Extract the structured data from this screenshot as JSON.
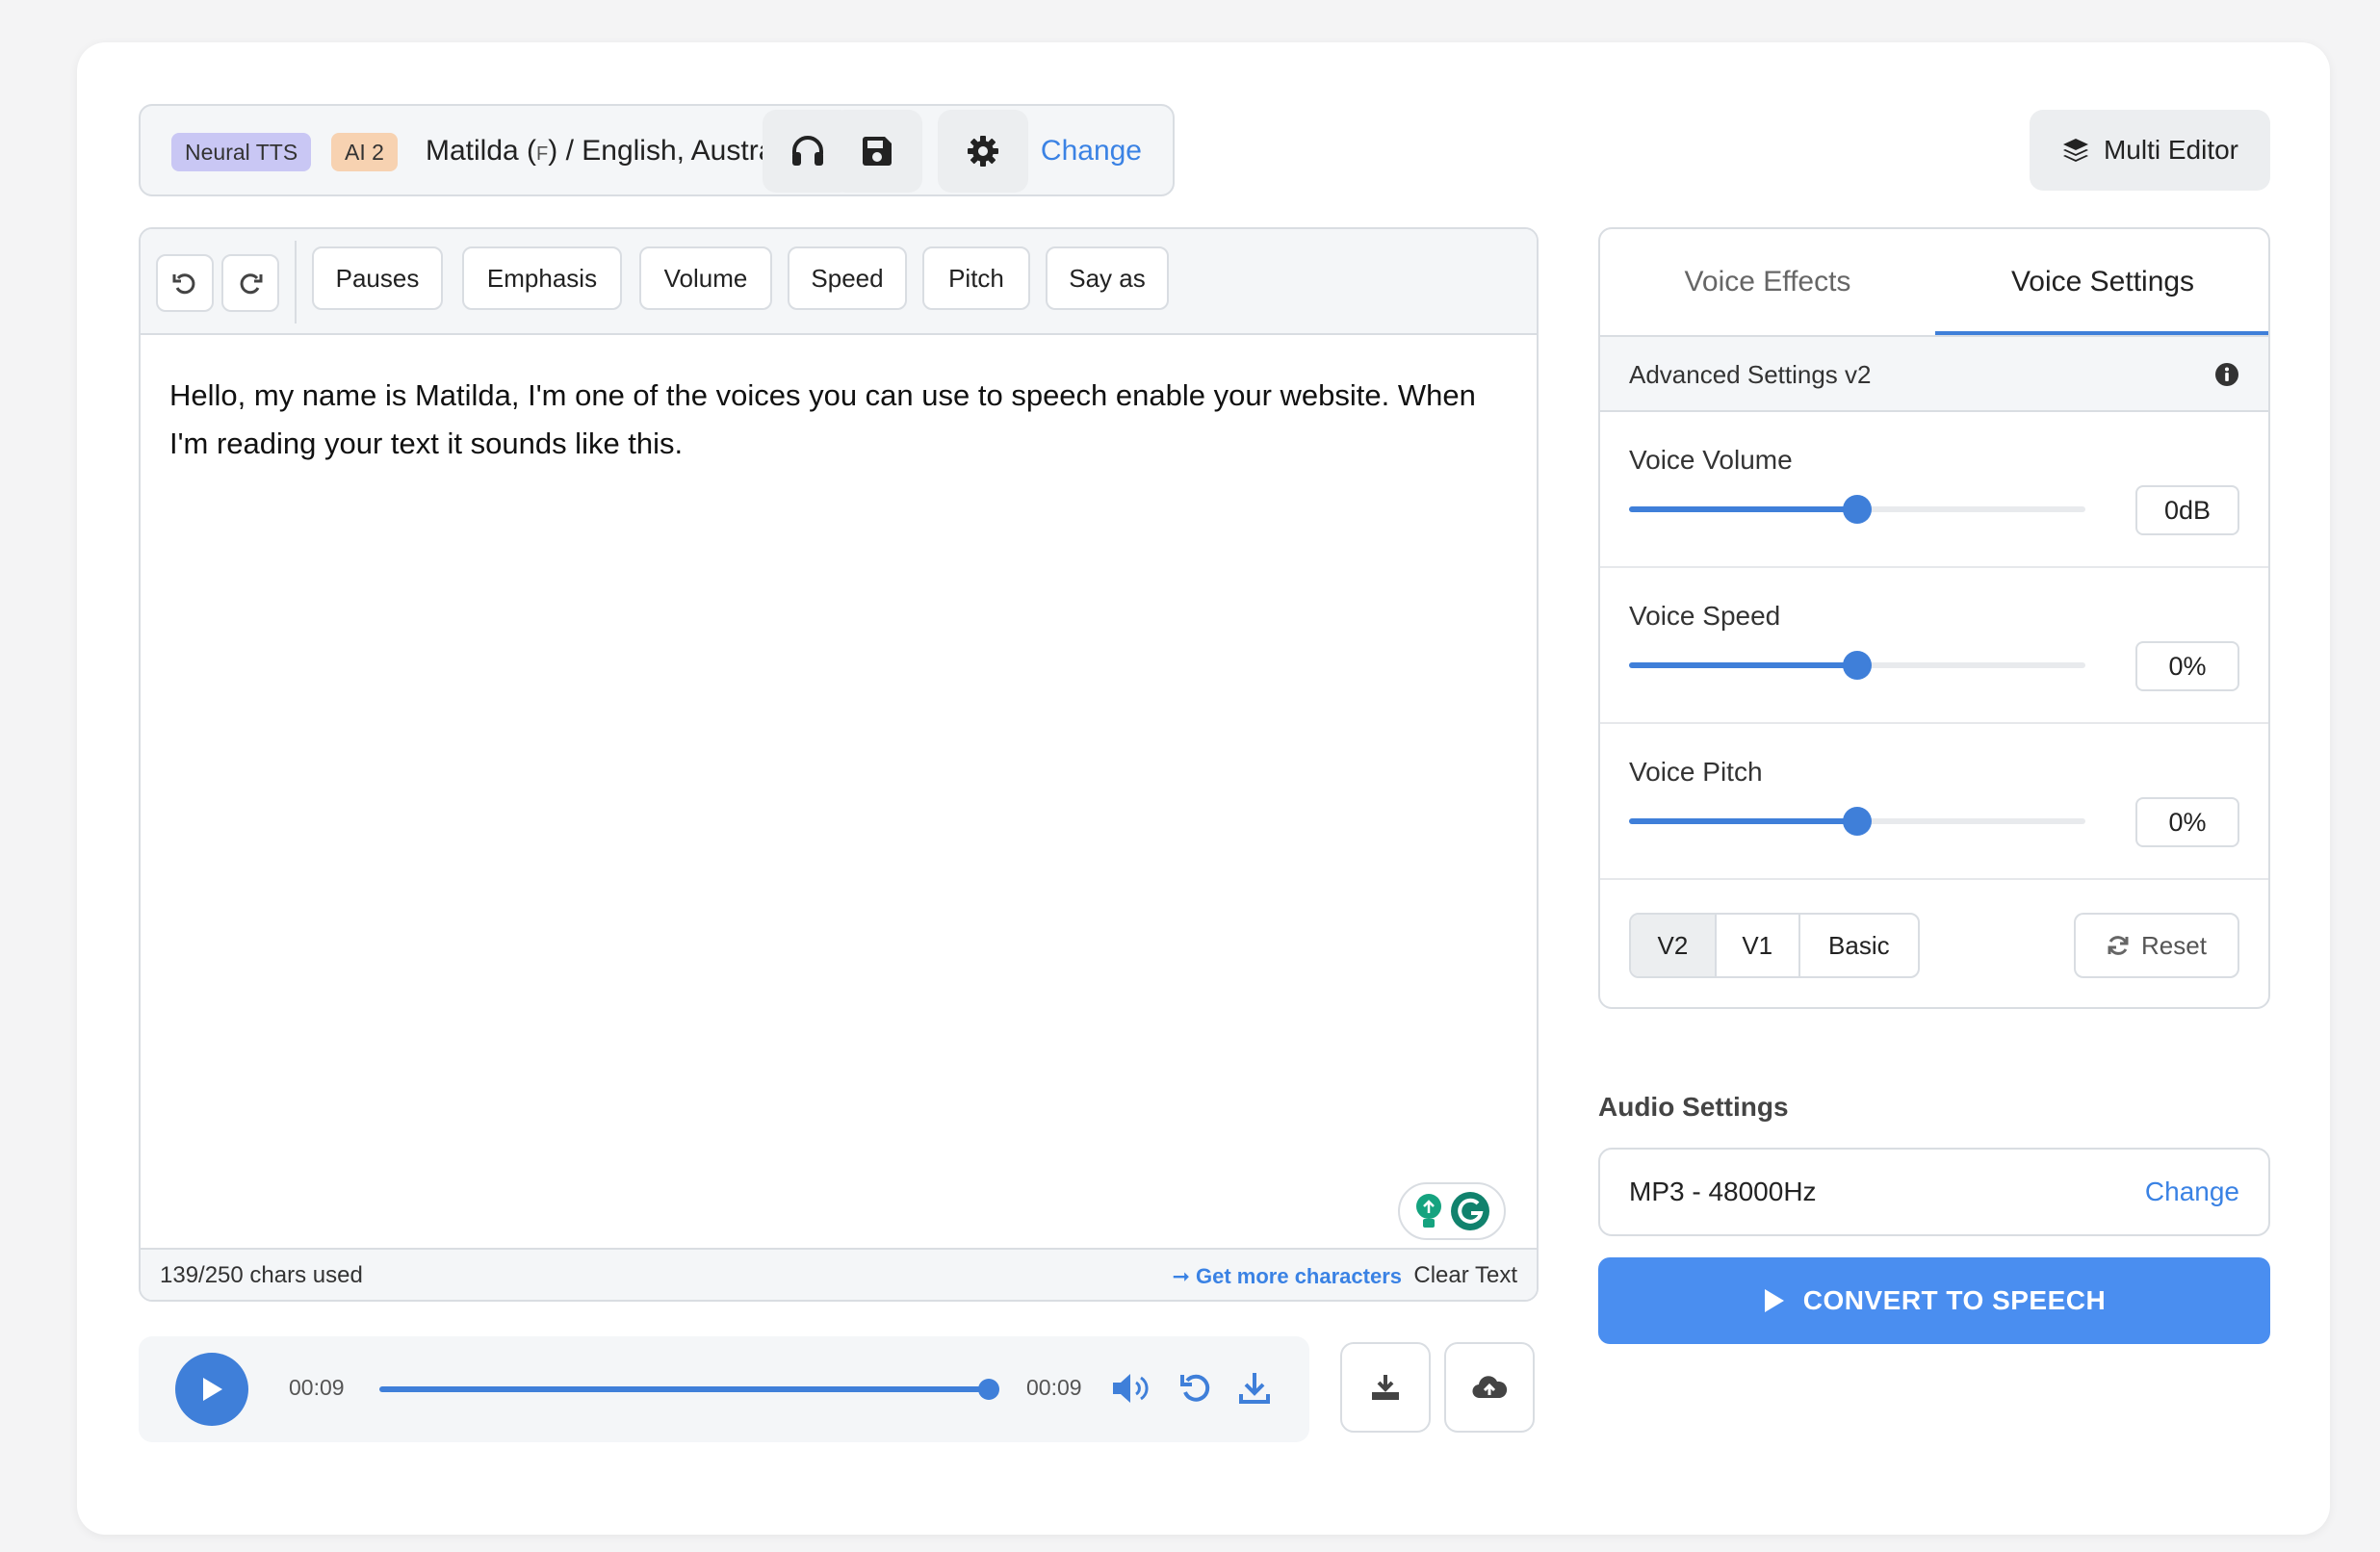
{
  "voice": {
    "engine_badge": "Neural TTS",
    "model_badge": "AI 2",
    "name": "Matilda (",
    "gender": "F",
    "name_suffix": ") / English, Australian",
    "change_label": "Change"
  },
  "header_actions": {
    "listen_icon": "headphones-icon",
    "save_icon": "save-icon",
    "settings_icon": "gear-icon",
    "multi_editor_label": "Multi Editor",
    "multi_editor_icon": "layers-icon"
  },
  "editor": {
    "toolbar": {
      "undo_icon": "undo-icon",
      "redo_icon": "redo-icon",
      "buttons": [
        "Pauses",
        "Emphasis",
        "Volume",
        "Speed",
        "Pitch",
        "Say as"
      ]
    },
    "text": "Hello, my name is Matilda, I'm one of the voices you can use to speech enable your website. When I'm reading your text it sounds like this.",
    "chars_used": "139/250 chars used",
    "get_more_label": "➞ Get more characters",
    "clear_label": "Clear Text"
  },
  "player": {
    "current_time": "00:09",
    "total_time": "00:09",
    "progress": 1.0,
    "icons": [
      "play-icon",
      "volume-icon",
      "replay-icon",
      "download-icon"
    ],
    "side_buttons": [
      "download-tray-icon",
      "cloud-upload-icon"
    ]
  },
  "right_panel": {
    "tabs": [
      {
        "label": "Voice Effects",
        "active": false
      },
      {
        "label": "Voice Settings",
        "active": true
      }
    ],
    "advanced_title": "Advanced Settings v2",
    "settings": [
      {
        "label": "Voice Volume",
        "value": "0dB",
        "level": 0.5
      },
      {
        "label": "Voice Speed",
        "value": "0%",
        "level": 0.5
      },
      {
        "label": "Voice Pitch",
        "value": "0%",
        "level": 0.5
      }
    ],
    "versions": [
      {
        "label": "V2",
        "active": true
      },
      {
        "label": "V1",
        "active": false
      },
      {
        "label": "Basic",
        "active": false
      }
    ],
    "reset_label": "Reset"
  },
  "audio": {
    "section_label": "Audio Settings",
    "format": "MP3 - 48000Hz",
    "change_label": "Change"
  },
  "convert_label": "CONVERT TO SPEECH",
  "colors": {
    "accent": "#3f7fd9",
    "convert_button": "#4a8ef0",
    "neural_badge": "#c9c7f4",
    "ai_badge": "#f7d2b1"
  }
}
